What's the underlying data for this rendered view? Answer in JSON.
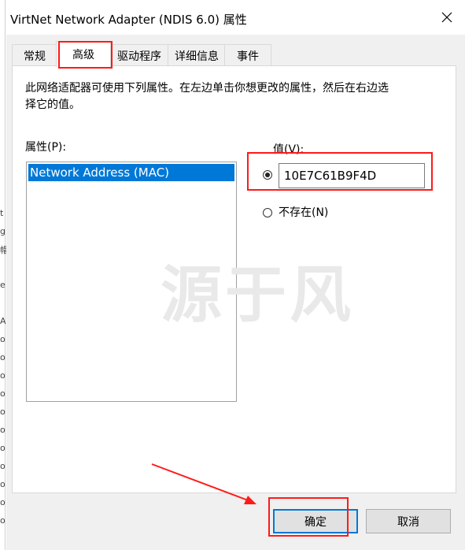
{
  "window": {
    "title": "VirtNet Network Adapter (NDIS 6.0) 属性"
  },
  "tabs": [
    {
      "label": "常规",
      "active": false
    },
    {
      "label": "高级",
      "active": true
    },
    {
      "label": "驱动程序",
      "active": false
    },
    {
      "label": "详细信息",
      "active": false
    },
    {
      "label": "事件",
      "active": false
    }
  ],
  "panel": {
    "description": "此网络适配器可使用下列属性。在左边单击你想更改的属性，然后在右边选择它的值。",
    "properties_label": "属性(P):",
    "properties": [
      "Network Address (MAC)"
    ],
    "value_label": "值(V):",
    "value": "10E7C61B9F4D",
    "not_exist_label": "不存在(N)",
    "selected_option": "value"
  },
  "watermark": "源于风",
  "buttons": {
    "ok": "确定",
    "cancel": "取消"
  },
  "background_window_chars": [
    "t",
    "g",
    "帽",
    "e",
    "A",
    "o",
    "o",
    "o",
    "o",
    "o",
    "o",
    "o",
    "o",
    "o",
    "o",
    "o"
  ],
  "colors": {
    "accent": "#0078d7",
    "annotation": "#ff1a1a"
  }
}
